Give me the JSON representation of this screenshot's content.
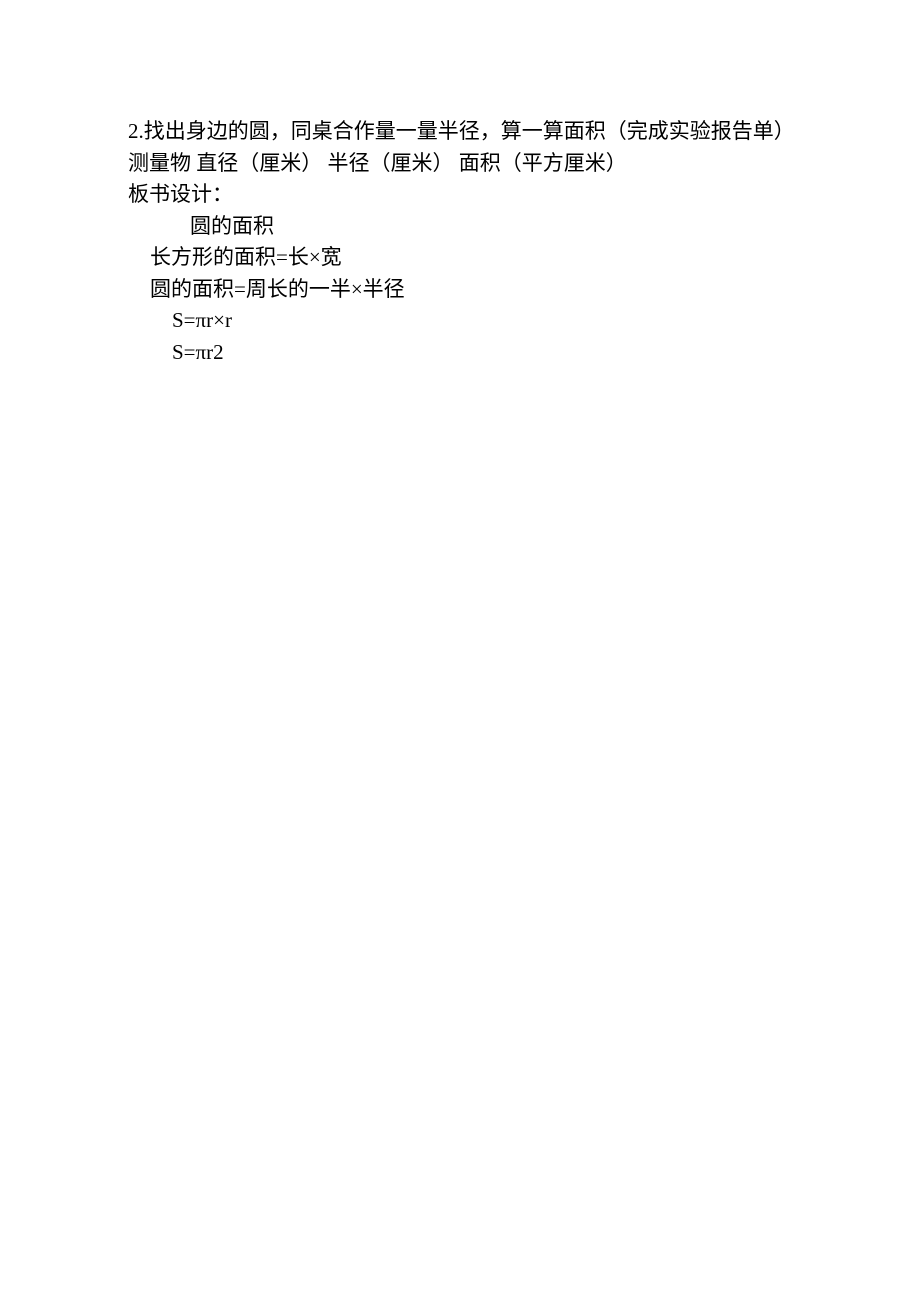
{
  "lines": {
    "l1": "2.找出身边的圆，同桌合作量一量半径，算一算面积（完成实验报告单）",
    "l2": "测量物  直径（厘米）  半径（厘米）  面积（平方厘米）",
    "l3": "板书设计：",
    "l4": "圆的面积",
    "l5": "长方形的面积=长×宽",
    "l6": "圆的面积=周长的一半×半径",
    "l7": "S=πr×r",
    "l8": "S=πr2"
  }
}
